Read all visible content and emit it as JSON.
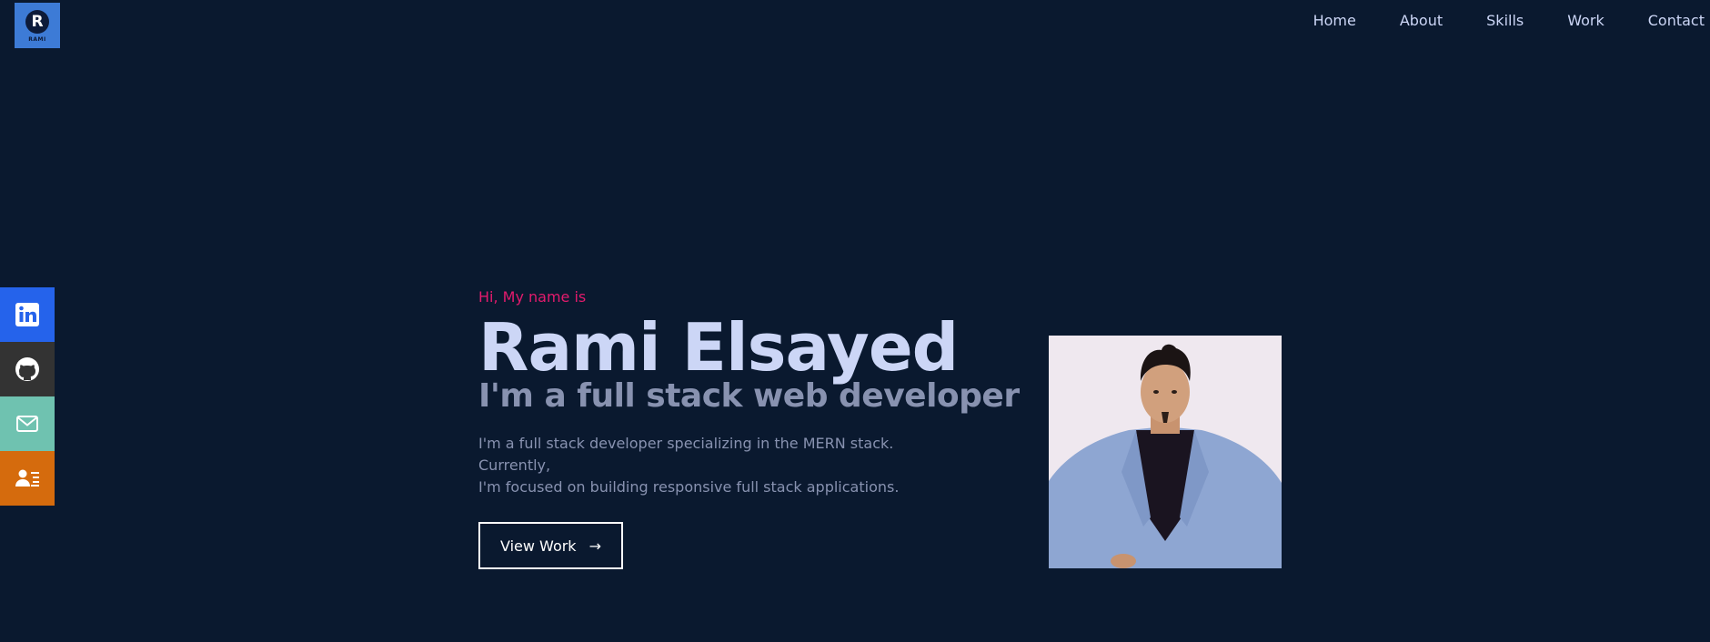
{
  "logo": {
    "letter": "R",
    "text": "RAMI"
  },
  "nav": {
    "items": [
      {
        "label": "Home"
      },
      {
        "label": "About"
      },
      {
        "label": "Skills"
      },
      {
        "label": "Work"
      },
      {
        "label": "Contact"
      }
    ]
  },
  "social": {
    "items": [
      {
        "icon": "linkedin-icon",
        "color": "#2563eb"
      },
      {
        "icon": "github-icon",
        "color": "#333333"
      },
      {
        "icon": "email-icon",
        "color": "#6fc2b0"
      },
      {
        "icon": "resume-icon",
        "color": "#d56b0d"
      }
    ]
  },
  "hero": {
    "greeting": "Hi, My name is",
    "name": "Rami Elsayed",
    "tagline": "I'm a full stack web developer",
    "bio_line1": "I'm a full stack developer specializing in the MERN stack. Currently,",
    "bio_line2": "I'm focused on building responsive full stack applications.",
    "cta_label": "View Work",
    "cta_arrow": "→"
  },
  "colors": {
    "background": "#0a192f",
    "accent": "#e31b6d",
    "heading": "#ccd6f6",
    "muted": "#8892b0"
  }
}
